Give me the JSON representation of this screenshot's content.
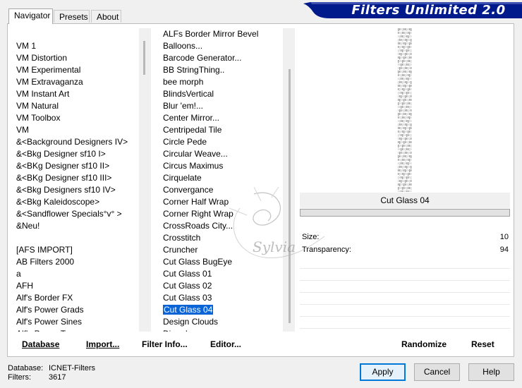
{
  "tabs": [
    {
      "label": "Navigator",
      "active": true
    },
    {
      "label": "Presets",
      "active": false
    },
    {
      "label": "About",
      "active": false
    }
  ],
  "title": "Filters Unlimited 2.0",
  "categories": [
    "VM 1",
    "VM Distortion",
    "VM Experimental",
    "VM Extravaganza",
    "VM Instant Art",
    "VM Natural",
    "VM Toolbox",
    "VM",
    "&<Background Designers IV>",
    "&<Bkg Designer sf10 I>",
    "&<BKg Designer sf10 II>",
    "&<BKg Designer sf10 III>",
    "&<Bkg Designers sf10 IV>",
    "&<Bkg Kaleidoscope>",
    "&<Sandflower Specials°v° >",
    "&Neu!",
    "",
    "[AFS IMPORT]",
    "AB Filters 2000",
    "a",
    "AFH",
    "Alf's Border FX",
    "Alf's Power Grads",
    "Alf's Power Sines",
    "Alf's Power Toys"
  ],
  "filters": [
    "ALFs Border Mirror Bevel",
    "Balloons...",
    "Barcode Generator...",
    "BB StringThing..",
    "bee morph",
    "BlindsVertical",
    "Blur 'em!...",
    "Center Mirror...",
    "Centripedal Tile",
    "Circle Pede",
    "Circular Weave...",
    "Circus Maximus",
    "Cirquelate",
    "Convergance",
    "Corner Half Wrap",
    "Corner Right Wrap",
    "CrossRoads City...",
    "Crosstitch",
    "Cruncher",
    "Cut Glass  BugEye",
    "Cut Glass 01",
    "Cut Glass 02",
    "Cut Glass 03",
    "Cut Glass 04",
    "Design Clouds",
    "Disorder"
  ],
  "selected_filter": "Cut Glass 04",
  "preview_label": "Cut Glass 04",
  "params": [
    {
      "label": "Size:",
      "value": "10"
    },
    {
      "label": "Transparency:",
      "value": "94"
    }
  ],
  "toolbar": {
    "database": "Database",
    "import": "Import...",
    "filter_info": "Filter Info...",
    "editor": "Editor...",
    "randomize": "Randomize",
    "reset": "Reset"
  },
  "status": {
    "database_label": "Database:",
    "database_value": "ICNET-Filters",
    "filters_label": "Filters:",
    "filters_value": "3617"
  },
  "buttons": {
    "apply": "Apply",
    "cancel": "Cancel",
    "help": "Help"
  },
  "watermark": "Sylvia",
  "colors": {
    "banner": "#001a8c",
    "selection": "#0a64d6",
    "default_button_border": "#0078d7"
  }
}
